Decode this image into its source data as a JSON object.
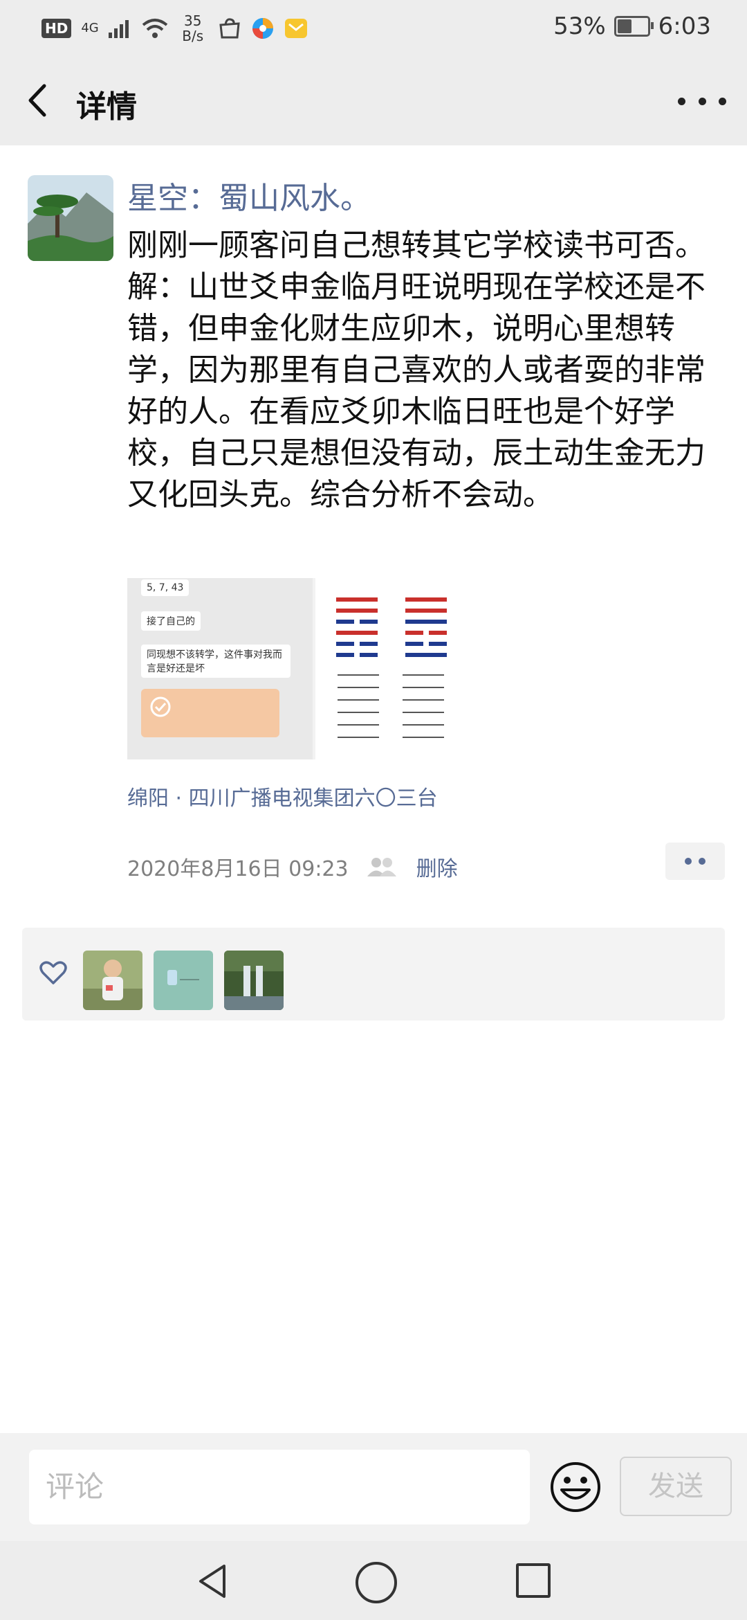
{
  "status_bar": {
    "hd": "HD",
    "network": "4G",
    "speed_value": "35",
    "speed_unit": "B/s",
    "battery": "53%",
    "time": "6:03"
  },
  "header": {
    "title": "详情"
  },
  "post": {
    "author": "星空：蜀山风水。",
    "content": "刚刚一顾客问自己想转其它学校读书可否。解：山世爻申金临月旺说明现在学校还是不错，但申金化财生应卯木，说明心里想转学，因为那里有自己喜欢的人或者耍的非常好的人。在看应爻卯木临日旺也是个好学校，自己只是想但没有动，辰土动生金无力又化回头克。综合分析不会动。",
    "location": "绵阳 · 四川广播电视集团六〇三台",
    "timestamp": "2020年8月16日 09:23",
    "delete_label": "删除"
  },
  "comment_bar": {
    "placeholder": "评论",
    "send_label": "发送"
  },
  "colors": {
    "link": "#576b95",
    "bar_bg": "#ededed"
  }
}
